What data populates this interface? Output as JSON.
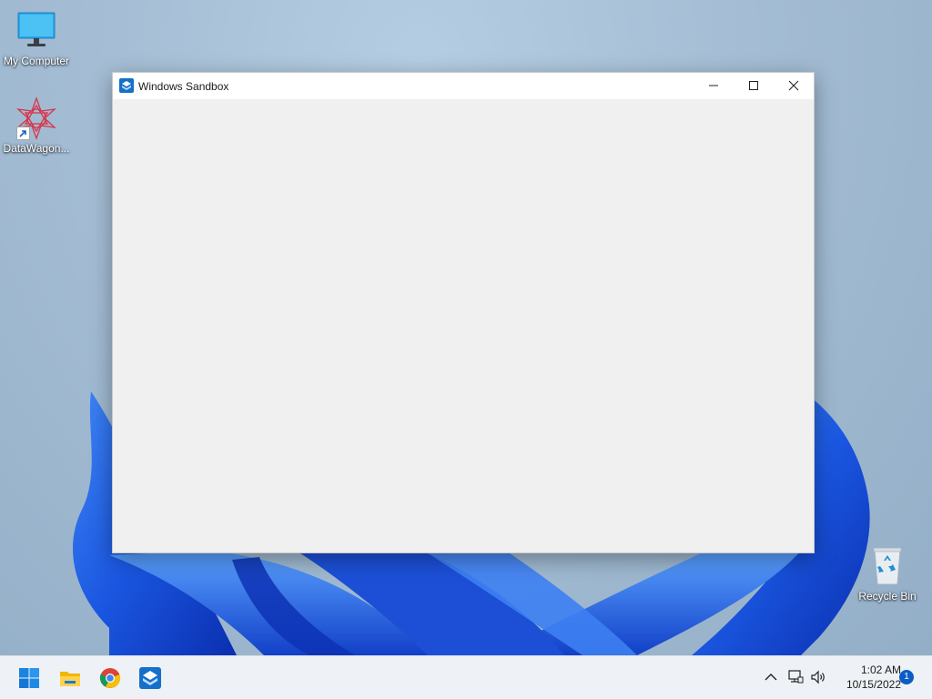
{
  "desktop": {
    "icons": [
      {
        "label": "My Computer",
        "icon": "monitor-icon"
      },
      {
        "label": "DataWagon...",
        "icon": "datawagon-icon"
      },
      {
        "label": "Recycle Bin",
        "icon": "recycle-bin-icon"
      }
    ]
  },
  "window": {
    "title": "Windows Sandbox",
    "icon": "sandbox-icon",
    "controls": [
      "minimize-icon",
      "maximize-icon",
      "close-icon"
    ]
  },
  "taskbar": {
    "apps": [
      {
        "icon": "start-icon"
      },
      {
        "icon": "file-explorer-icon"
      },
      {
        "icon": "chrome-icon"
      },
      {
        "icon": "sandbox-icon"
      }
    ],
    "tray": {
      "icons": [
        "chevron-up-icon",
        "network-icon",
        "volume-icon"
      ],
      "time": "1:02 AM",
      "date": "10/15/2022",
      "notification_count": "1"
    }
  },
  "colors": {
    "accent": "#0b5cc4",
    "bloom": "#1a5ee8",
    "taskbar": "#eef1f5",
    "window_body": "#f0f0f0"
  }
}
